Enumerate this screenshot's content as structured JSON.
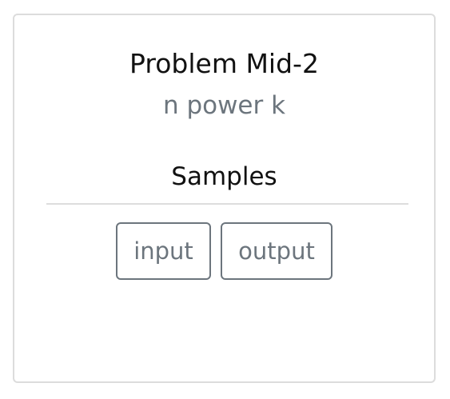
{
  "problem": {
    "title": "Problem Mid-2",
    "subtitle": "n power k"
  },
  "samples": {
    "heading": "Samples",
    "buttons": {
      "input_label": "input",
      "output_label": "output"
    }
  },
  "colors": {
    "muted": "#6c757d",
    "border": "#dcdcdc",
    "divider": "#dddddd",
    "text": "#111111"
  }
}
